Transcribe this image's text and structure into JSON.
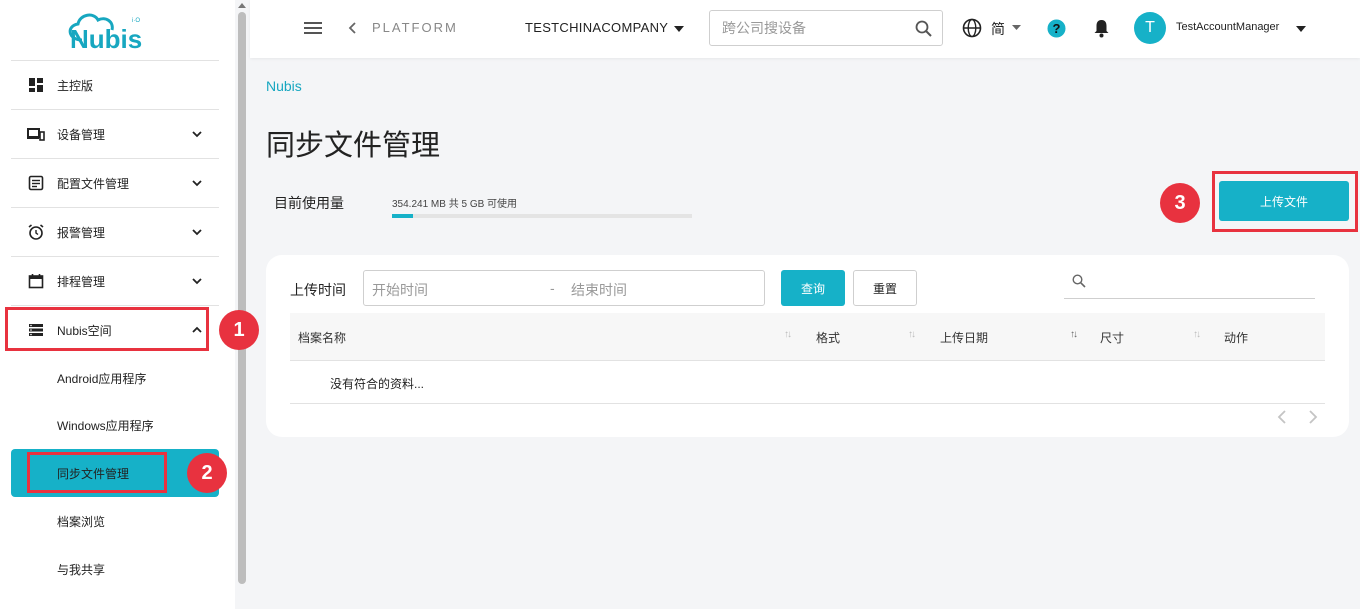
{
  "brand": {
    "logo_text": "Nubis",
    "logo_superscript": "i·O"
  },
  "sidebar": {
    "items": [
      {
        "label": "主控版",
        "icon": "dashboard-icon"
      },
      {
        "label": "设备管理",
        "icon": "devices-icon"
      },
      {
        "label": "配置文件管理",
        "icon": "profile-icon"
      },
      {
        "label": "报警管理",
        "icon": "alarm-icon"
      },
      {
        "label": "排程管理",
        "icon": "calendar-icon"
      },
      {
        "label": "Nubis空间",
        "icon": "storage-icon"
      }
    ],
    "sub_items": [
      {
        "label": "Android应用程序"
      },
      {
        "label": "Windows应用程序"
      },
      {
        "label": "同步文件管理"
      },
      {
        "label": "档案浏览"
      },
      {
        "label": "与我共享"
      }
    ]
  },
  "topbar": {
    "platform": "PLATFORM",
    "company": "TESTCHINACOMPANY",
    "search_placeholder": "跨公司搜设备",
    "language": "简",
    "avatar_initial": "T",
    "user_name": "TestAccountManager"
  },
  "main": {
    "breadcrumb": "Nubis",
    "title": "同步文件管理",
    "usage_label": "目前使用量",
    "usage_text": "354.241 MB 共 5 GB 可使用",
    "usage_fraction": 0.069,
    "upload_button": "上传文件",
    "filter": {
      "label": "上传时间",
      "start_placeholder": "开始时间",
      "separator": "-",
      "end_placeholder": "结束时间",
      "query_button": "查询",
      "reset_button": "重置"
    },
    "table": {
      "columns": [
        "档案名称",
        "格式",
        "上传日期",
        "尺寸",
        "动作"
      ],
      "empty_text": "没有符合的资料..."
    }
  },
  "annotations": {
    "step1": "1",
    "step2": "2",
    "step3": "3"
  },
  "colors": {
    "accent": "#16b1c8",
    "annotation": "#e8323f"
  }
}
